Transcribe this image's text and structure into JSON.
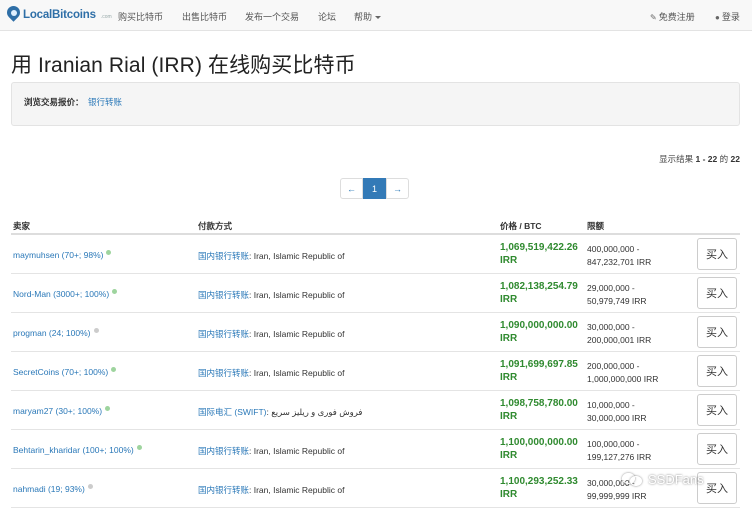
{
  "nav": {
    "brand": "LocalBitcoins",
    "brand_suffix": ".com",
    "links": [
      "购买比特币",
      "出售比特币",
      "发布一个交易",
      "论坛",
      "帮助"
    ],
    "signup": "免费注册",
    "login": "登录"
  },
  "page": {
    "title": "用 Iranian Rial (IRR) 在线购买比特币",
    "filter_label": "浏览交易报价：",
    "filter_link": "银行转账",
    "results_prefix": "显示结果",
    "results_range": "1 - 22",
    "results_mid": "的",
    "results_total": "22"
  },
  "pagination": {
    "prev": "←",
    "current": "1",
    "next": "→"
  },
  "table": {
    "headers": {
      "trader": "卖家",
      "method": "付款方式",
      "price": "价格 / BTC",
      "limits": "限额"
    },
    "buy_label": "买入",
    "rows": [
      {
        "trader": "maymuhsen (70+; 98%)",
        "method_link": "国内银行转账",
        "method_rest": ": Iran, Islamic Republic of",
        "price": "1,069,519,422.26",
        "currency": "IRR",
        "limit_min": "400,000,000 -",
        "limit_max": "847,232,701 IRR"
      },
      {
        "trader": "Nord-Man (3000+; 100%)",
        "method_link": "国内银行转账",
        "method_rest": ": Iran, Islamic Republic of",
        "price": "1,082,138,254.79",
        "currency": "IRR",
        "limit_min": "29,000,000 -",
        "limit_max": "50,979,749 IRR"
      },
      {
        "trader": "progman (24; 100%)",
        "method_link": "国内银行转账",
        "method_rest": ": Iran, Islamic Republic of",
        "price": "1,090,000,000.00",
        "currency": "IRR",
        "limit_min": "30,000,000 -",
        "limit_max": "200,000,001 IRR"
      },
      {
        "trader": "SecretCoins (70+; 100%)",
        "method_link": "国内银行转账",
        "method_rest": ": Iran, Islamic Republic of",
        "price": "1,091,699,697.85",
        "currency": "IRR",
        "limit_min": "200,000,000 -",
        "limit_max": "1,000,000,000 IRR"
      },
      {
        "trader": "maryam27 (30+; 100%)",
        "method_link": "国际电汇 (SWIFT)",
        "method_rest": ": فروش فوری و ریلیز سریع",
        "price": "1,098,758,780.00",
        "currency": "IRR",
        "limit_min": "10,000,000 -",
        "limit_max": "30,000,000 IRR"
      },
      {
        "trader": "Behtarin_kharidar (100+; 100%)",
        "method_link": "国内银行转账",
        "method_rest": ": Iran, Islamic Republic of",
        "price": "1,100,000,000.00",
        "currency": "IRR",
        "limit_min": "100,000,000 -",
        "limit_max": "199,127,276 IRR"
      },
      {
        "trader": "nahmadi (19; 93%)",
        "method_link": "国内银行转账",
        "method_rest": ": Iran, Islamic Republic of",
        "price": "1,100,293,252.33",
        "currency": "IRR",
        "limit_min": "30,000,000 -",
        "limit_max": "99,999,999 IRR"
      }
    ]
  },
  "watermark": "SSDFans",
  "colors": {
    "link": "#2a78b8",
    "price": "#2f8a2f",
    "online_dot": "#9ed49e",
    "offline_dot": "#cccccc",
    "active_page": "#337ab7"
  }
}
